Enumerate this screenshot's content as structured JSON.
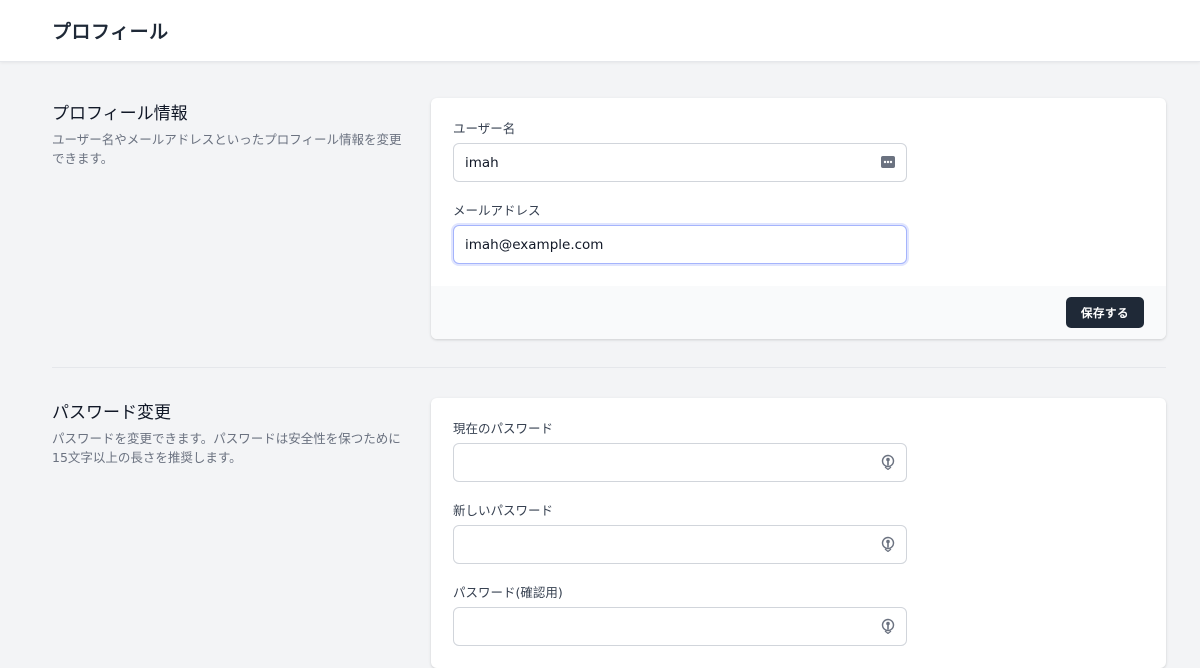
{
  "header": {
    "title": "プロフィール"
  },
  "profile_section": {
    "title": "プロフィール情報",
    "description": "ユーザー名やメールアドレスといったプロフィール情報を変更できます。",
    "fields": {
      "username": {
        "label": "ユーザー名",
        "value": "imah",
        "icon": "password-manager-icon"
      },
      "email": {
        "label": "メールアドレス",
        "value": "imah@example.com"
      }
    },
    "save_label": "保存する"
  },
  "password_section": {
    "title": "パスワード変更",
    "description": "パスワードを変更できます。パスワードは安全性を保つために15文字以上の長さを推奨します。",
    "fields": {
      "current": {
        "label": "現在のパスワード",
        "value": "",
        "icon": "key-icon"
      },
      "new": {
        "label": "新しいパスワード",
        "value": "",
        "icon": "key-icon"
      },
      "confirm": {
        "label": "パスワード(確認用)",
        "value": "",
        "icon": "key-icon"
      }
    }
  },
  "colors": {
    "background": "#f3f4f6",
    "button": "#1f2937",
    "focus_ring": "#a5b4fc"
  }
}
